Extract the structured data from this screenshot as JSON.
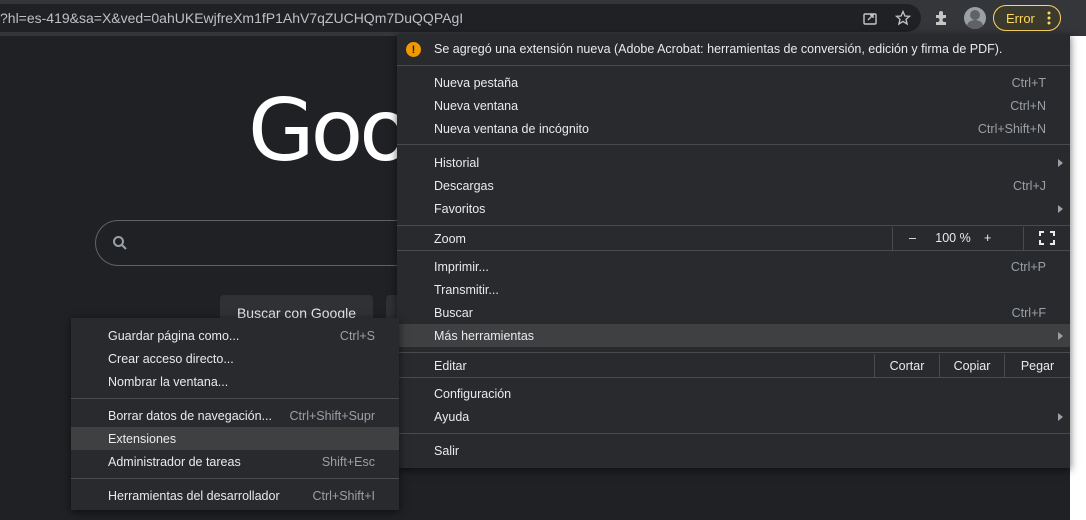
{
  "toolbar": {
    "url": "?hl=es-419&sa=X&ved=0ahUKEwjfreXm1fP1AhV7qZUCHQm7DuQQPAgI",
    "icons": [
      "share-icon",
      "star-icon",
      "extensions-puzzle-icon"
    ],
    "error_label": "Error"
  },
  "page": {
    "logo_text": "Goo",
    "search_button": "Buscar con Google"
  },
  "main_menu": {
    "notice": "Se agregó una extensión nueva (Adobe Acrobat: herramientas de conversión, edición y firma de PDF).",
    "items": [
      {
        "label": "Nueva pestaña",
        "shortcut": "Ctrl+T"
      },
      {
        "label": "Nueva ventana",
        "shortcut": "Ctrl+N"
      },
      {
        "label": "Nueva ventana de incógnito",
        "shortcut": "Ctrl+Shift+N"
      },
      {
        "label": "Historial",
        "shortcut": ""
      },
      {
        "label": "Descargas",
        "shortcut": "Ctrl+J"
      },
      {
        "label": "Favoritos",
        "shortcut": ""
      },
      {
        "label": "Zoom",
        "shortcut": ""
      },
      {
        "label": "Imprimir...",
        "shortcut": "Ctrl+P"
      },
      {
        "label": "Transmitir...",
        "shortcut": ""
      },
      {
        "label": "Buscar",
        "shortcut": "Ctrl+F"
      },
      {
        "label": "Más herramientas",
        "shortcut": ""
      },
      {
        "label": "Editar",
        "shortcut": ""
      },
      {
        "label": "Configuración",
        "shortcut": ""
      },
      {
        "label": "Ayuda",
        "shortcut": ""
      },
      {
        "label": "Salir",
        "shortcut": ""
      }
    ],
    "zoom": {
      "minus": "–",
      "value": "100 %",
      "plus": "+"
    },
    "edit": {
      "cut": "Cortar",
      "copy": "Copiar",
      "paste": "Pegar"
    }
  },
  "sub_menu": {
    "items": [
      {
        "label": "Guardar página como...",
        "shortcut": "Ctrl+S"
      },
      {
        "label": "Crear acceso directo...",
        "shortcut": ""
      },
      {
        "label": "Nombrar la ventana...",
        "shortcut": ""
      },
      {
        "label": "Borrar datos de navegación...",
        "shortcut": "Ctrl+Shift+Supr"
      },
      {
        "label": "Extensiones",
        "shortcut": ""
      },
      {
        "label": "Administrador de tareas",
        "shortcut": "Shift+Esc"
      },
      {
        "label": "Herramientas del desarrollador",
        "shortcut": "Ctrl+Shift+I"
      }
    ]
  }
}
